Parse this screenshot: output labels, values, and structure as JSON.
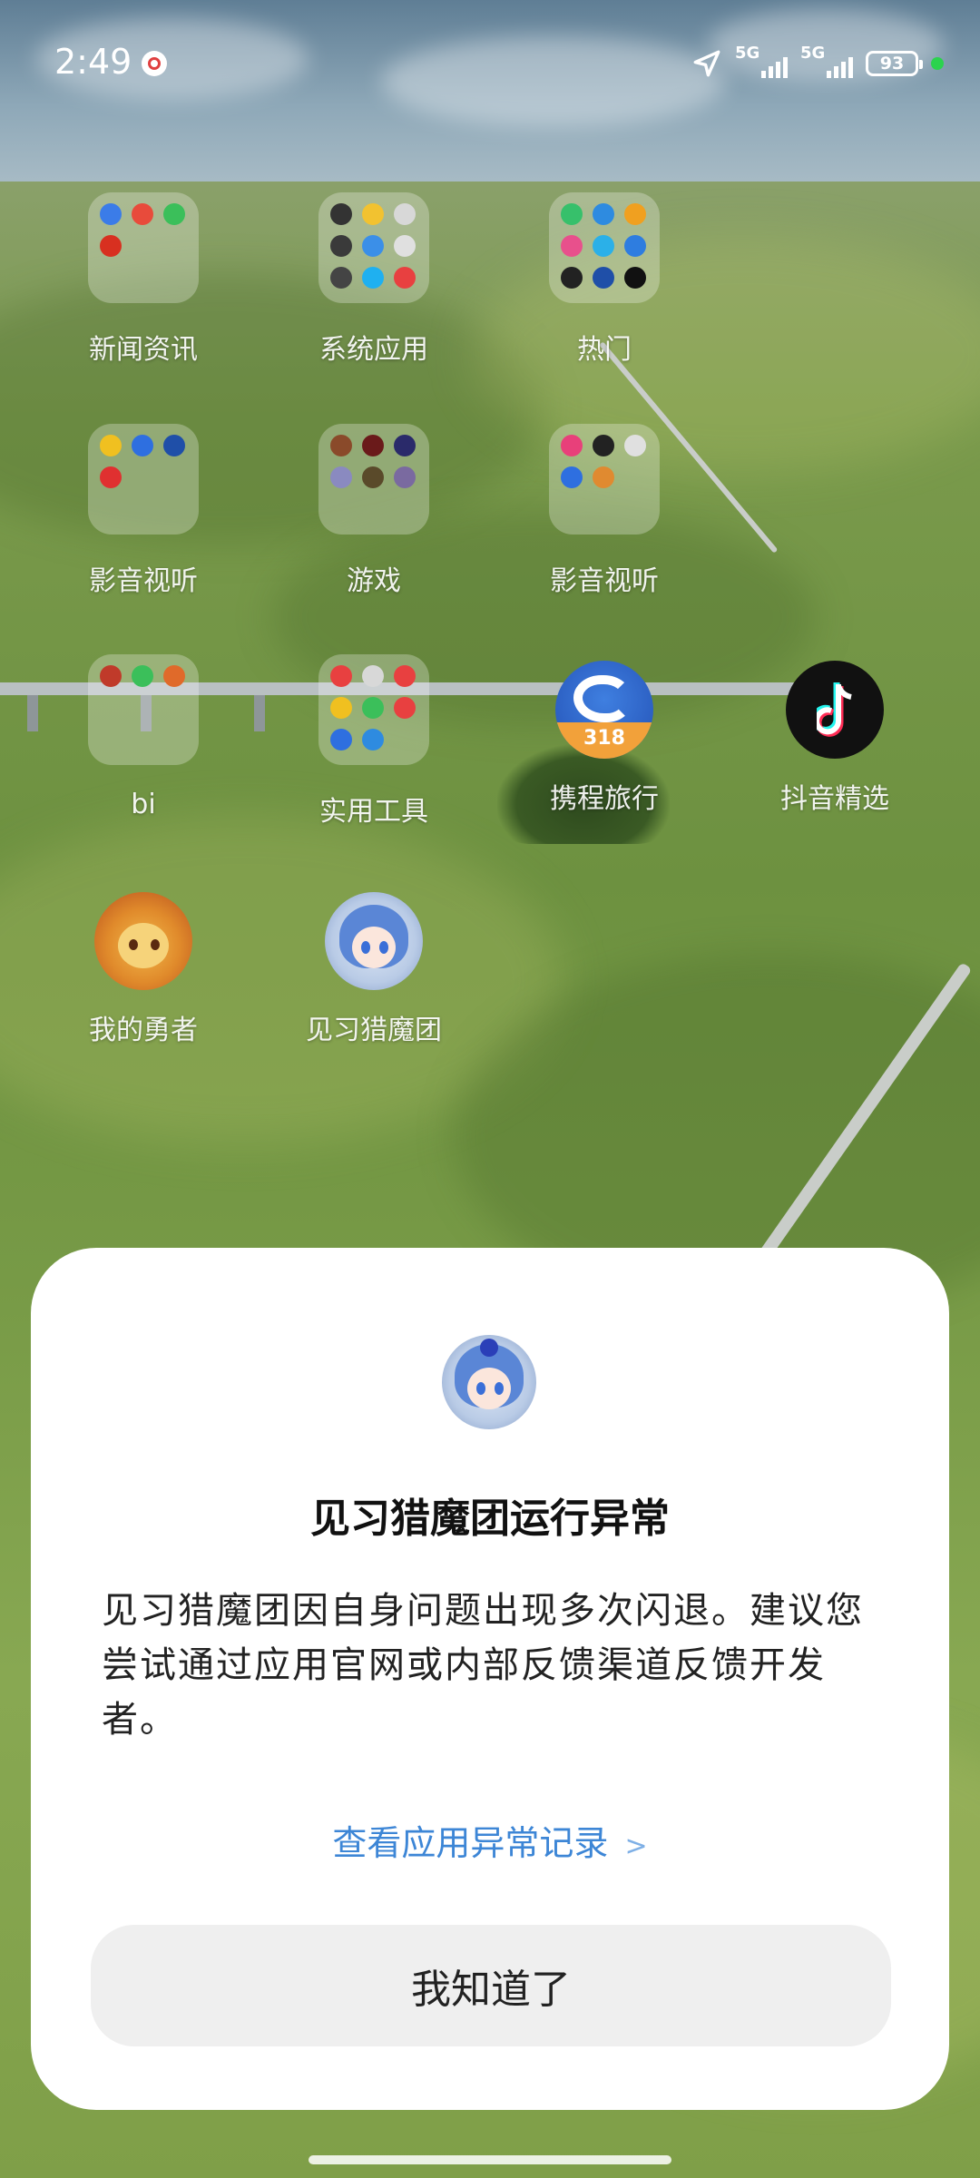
{
  "status_bar": {
    "time": "2:49",
    "signal1_label": "5G",
    "signal2_label": "5G",
    "battery": "93"
  },
  "home": {
    "folders": [
      {
        "label": "新闻资讯"
      },
      {
        "label": "系统应用"
      },
      {
        "label": "热门"
      },
      {
        "label": "影音视听"
      },
      {
        "label": "游戏"
      },
      {
        "label": "影音视听"
      },
      {
        "label": "bi"
      },
      {
        "label": "实用工具"
      }
    ],
    "apps": [
      {
        "label": "携程旅行",
        "badge_text": "318"
      },
      {
        "label": "抖音精选"
      },
      {
        "label": "我的勇者"
      },
      {
        "label": "见习猎魔团"
      }
    ]
  },
  "dialog": {
    "title": "见习猎魔团运行异常",
    "body": "见习猎魔团因自身问题出现多次闪退。建议您尝试通过应用官网或内部反馈渠道反馈开发者。",
    "link": "查看应用异常记录",
    "link_chevron": ">",
    "button": "我知道了"
  },
  "colors": {
    "link": "#3d86d6",
    "dialog_bg": "#ffffff",
    "button_bg": "#efefef"
  }
}
